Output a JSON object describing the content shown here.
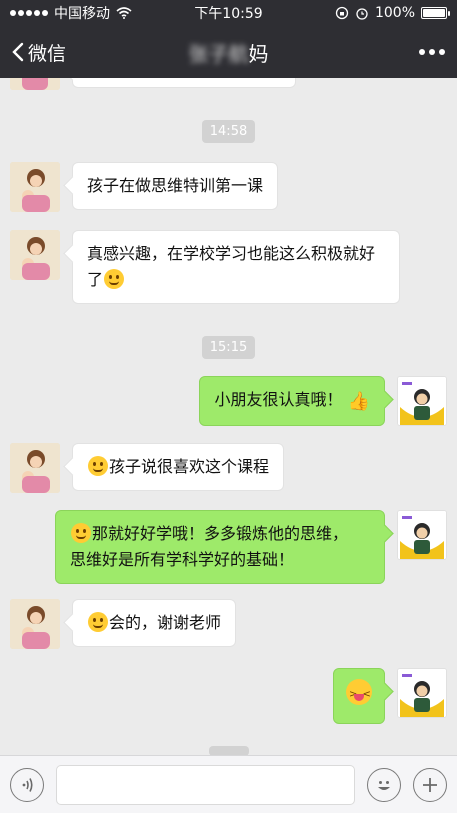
{
  "status_bar": {
    "carrier": "中国移动",
    "time": "下午10:59",
    "battery": "100%",
    "battery_level": 1.0
  },
  "nav": {
    "back_label": "微信",
    "title_blurred": "张子航",
    "title_suffix": "妈"
  },
  "messages": [
    {
      "type": "time",
      "text": "14:58"
    },
    {
      "type": "in",
      "text": "孩子在做思维特训第一课"
    },
    {
      "type": "in",
      "text": "真感兴趣，在学校学习也能这么积极就好了",
      "emoji": "thinking"
    },
    {
      "type": "time",
      "text": "15:15"
    },
    {
      "type": "out",
      "text": "小朋友很认真哦！",
      "emoji": "thumbs-up"
    },
    {
      "type": "in",
      "text": "孩子说很喜欢这个课程",
      "emoji_prefix": "smile"
    },
    {
      "type": "out",
      "line1": "那就好好学哦！多多锻炼他的思维，",
      "line2": "思维好是所有学科学好的基础！",
      "emoji_prefix": "thinking"
    },
    {
      "type": "in",
      "text": "会的，谢谢老师",
      "emoji_prefix": "smile"
    },
    {
      "type": "out",
      "emoji_only": "tongue-out"
    }
  ],
  "input": {
    "voice_icon": "voice-icon",
    "emoji_icon": "emoji-icon",
    "plus_icon": "plus-icon",
    "value": ""
  }
}
